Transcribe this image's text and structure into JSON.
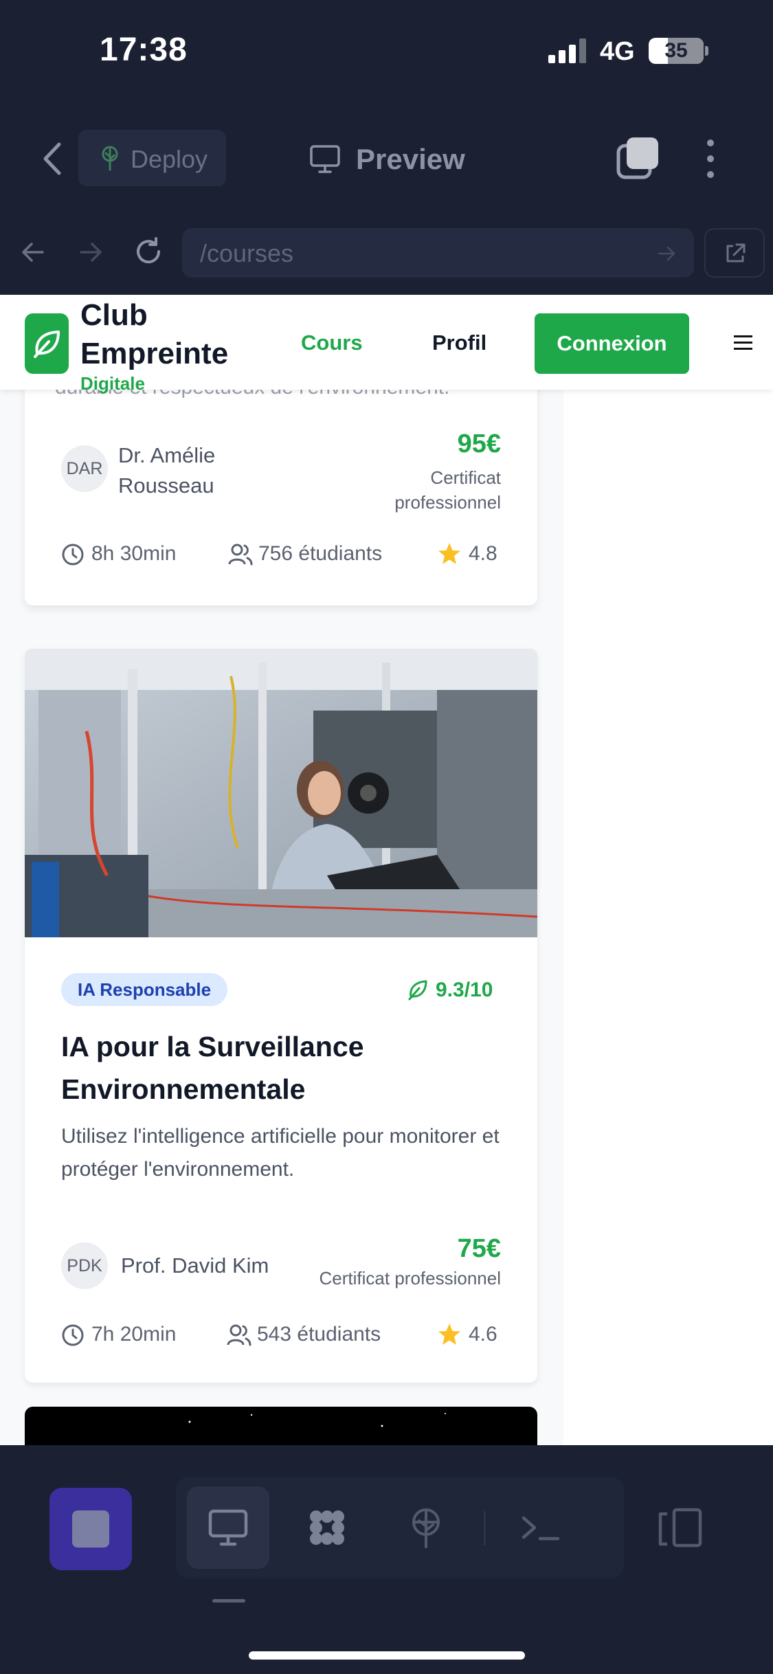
{
  "status_bar": {
    "time": "17:38",
    "network": "4G",
    "battery": "35"
  },
  "toolbar": {
    "deploy_label": "Deploy",
    "preview_label": "Preview"
  },
  "url_bar": {
    "url": "/courses"
  },
  "site": {
    "brand_line1": "Club",
    "brand_line2": "Empreinte",
    "brand_line3": "Digitale",
    "nav_cours": "Cours",
    "nav_profil": "Profil",
    "connexion": "Connexion"
  },
  "card1": {
    "partial_text": "durable et respectueux de l'environnement.",
    "avatar_initials": "DAR",
    "instructor_line1": "Dr. Amélie",
    "instructor_line2": "Rousseau",
    "price": "95€",
    "cert_line1": "Certificat",
    "cert_line2": "professionnel",
    "duration": "8h 30min",
    "students": "756 étudiants",
    "rating": "4.8"
  },
  "card2": {
    "badge": "IA Responsable",
    "score": "9.3/10",
    "title": "IA pour la Surveillance Environnementale",
    "description": "Utilisez l'intelligence artificielle pour monitorer et protéger l'environnement.",
    "avatar_initials": "PDK",
    "instructor": "Prof. David Kim",
    "price": "75€",
    "cert": "Certificat professionnel",
    "duration": "7h 20min",
    "students": "543 étudiants",
    "rating": "4.6"
  },
  "colors": {
    "brand_green": "#1ea84a",
    "badge_blue_bg": "#dbeafe",
    "star": "#fbbf24",
    "ide_dark": "#1b2033"
  },
  "icons": [
    "chevron-left-icon",
    "tree-icon",
    "monitor-icon",
    "tabs-icon",
    "more-vertical-icon",
    "arrow-left-icon",
    "arrow-right-icon",
    "reload-icon",
    "external-link-icon",
    "leaf-icon",
    "clock-icon",
    "users-icon",
    "star-icon",
    "stop-icon",
    "modules-icon",
    "deploy-icon",
    "terminal-icon",
    "devices-icon"
  ]
}
